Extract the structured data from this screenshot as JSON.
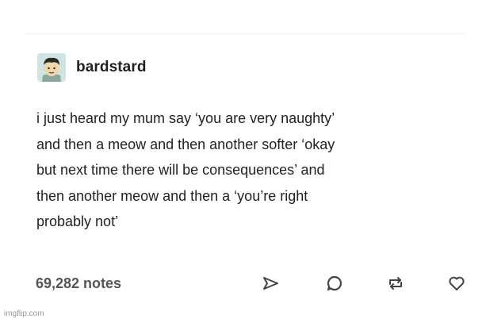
{
  "post": {
    "username": "bardstard",
    "text": "i just heard my mum say ‘you are very naughty’\nand then a meow and then another softer ‘okay\nbut next time there will be consequences’ and\nthen another meow and then a ‘you’re right\nprobably not’",
    "notes": "69,282 notes"
  },
  "icons": {
    "share": "paper-plane-icon",
    "reply": "speech-bubble-icon",
    "reblog": "reblog-icon",
    "like": "heart-icon"
  },
  "watermark": "imgflip.com",
  "colors": {
    "text": "#222222",
    "notes": "#555555",
    "icon": "#444444"
  }
}
